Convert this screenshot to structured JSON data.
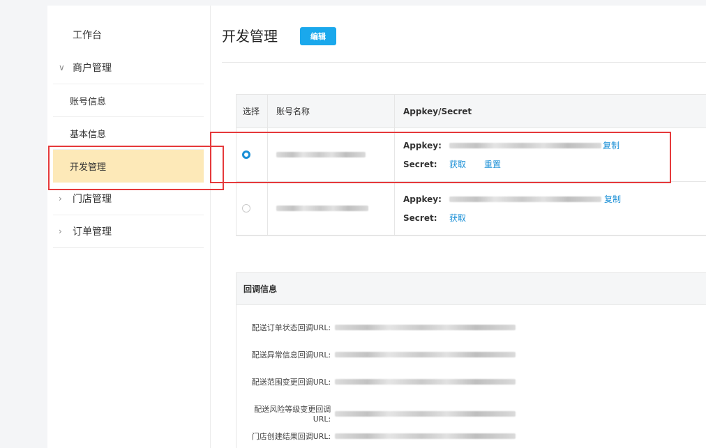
{
  "sidebar": {
    "items": [
      {
        "label": "工作台",
        "type": "top"
      },
      {
        "label": "商户管理",
        "type": "group",
        "expanded": true
      },
      {
        "label": "账号信息",
        "type": "sub"
      },
      {
        "label": "基本信息",
        "type": "sub"
      },
      {
        "label": "开发管理",
        "type": "sub",
        "active": true
      },
      {
        "label": "门店管理",
        "type": "group",
        "expanded": false
      },
      {
        "label": "订单管理",
        "type": "group",
        "expanded": false
      }
    ],
    "chevron_down": "∨",
    "chevron_right": "›"
  },
  "main": {
    "title": "开发管理",
    "edit_label": "编辑",
    "table": {
      "headers": [
        "选择",
        "账号名称",
        "Appkey/Secret"
      ],
      "rows": [
        {
          "selected": true,
          "appkey_label": "Appkey:",
          "copy_label": "复制",
          "secret_label": "Secret:",
          "get_label": "获取",
          "reset_label": "重置"
        },
        {
          "selected": false,
          "appkey_label": "Appkey:",
          "copy_label": "复制",
          "secret_label": "Secret:",
          "get_label": "获取"
        }
      ]
    },
    "callback": {
      "title": "回调信息",
      "rows": [
        {
          "label": "配送订单状态回调URL:"
        },
        {
          "label": "配送异常信息回调URL:"
        },
        {
          "label": "配送范围变更回调URL:"
        },
        {
          "label": "配送风险等级变更回调URL:"
        },
        {
          "label": "门店创建结果回调URL:"
        }
      ]
    }
  },
  "colors": {
    "accent": "#1aa8ec",
    "link": "#1a8fd6",
    "active_nav": "#fde9b8",
    "highlight_box": "#e5393b"
  }
}
